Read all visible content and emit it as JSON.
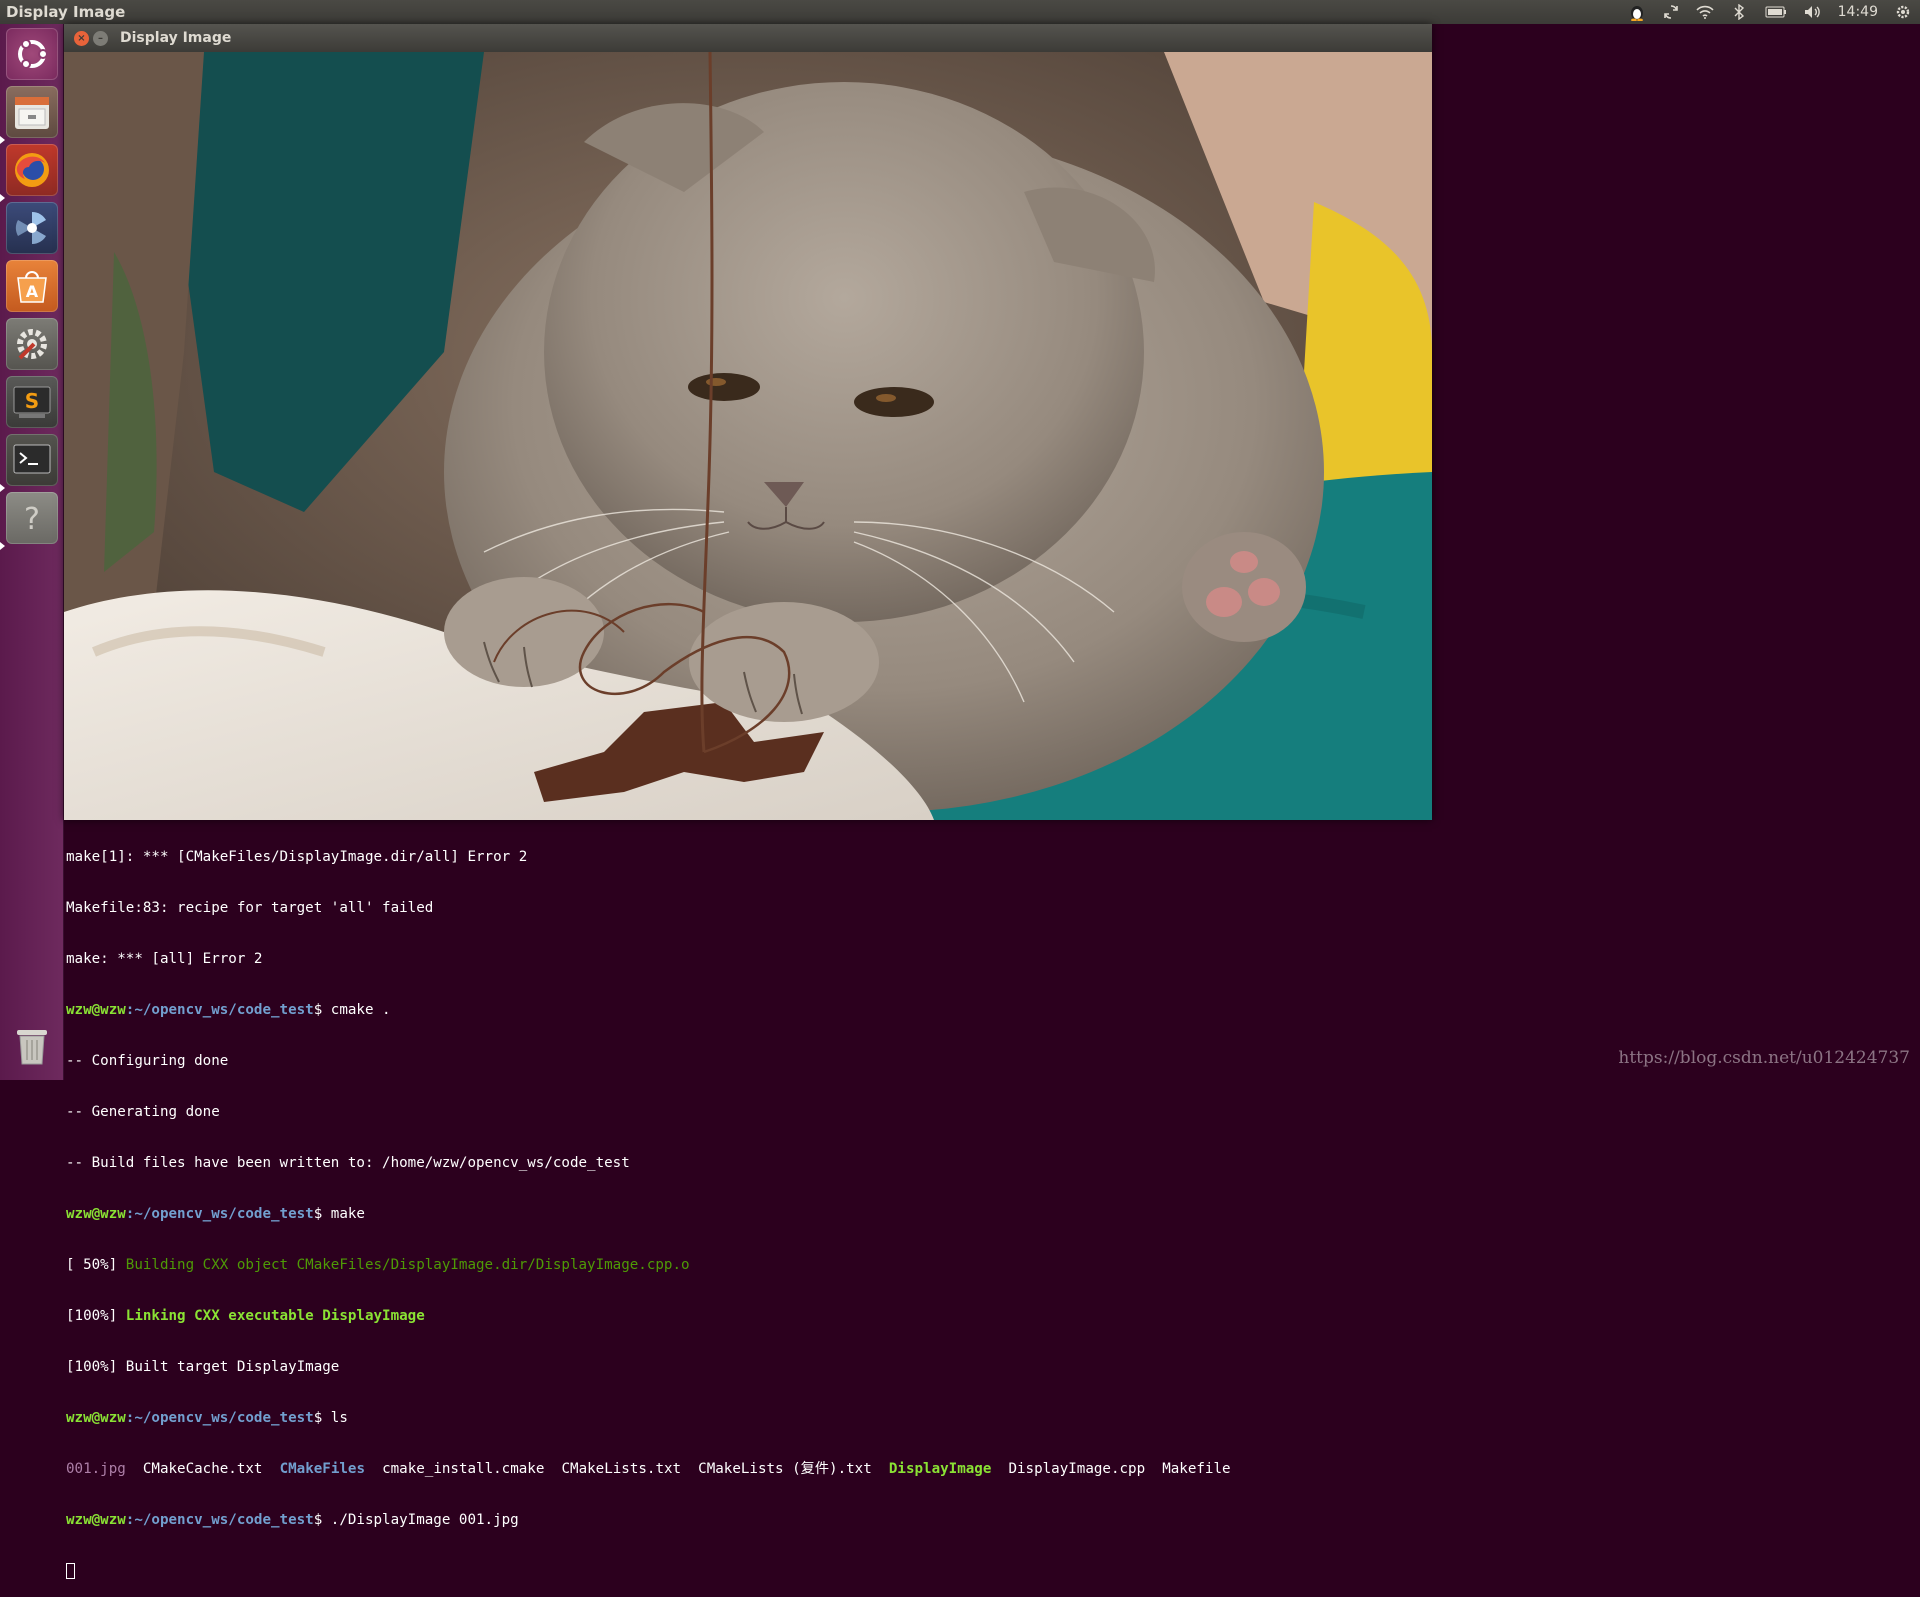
{
  "top_panel": {
    "app_title": "Display Image",
    "clock": "14:49",
    "tray_icons": [
      "qq-penguin-icon",
      "sync-icon",
      "wifi-icon",
      "bluetooth-icon",
      "battery-icon",
      "volume-icon",
      "gear-icon"
    ]
  },
  "launcher": {
    "items": [
      "ubuntu-dash-icon",
      "files-icon",
      "firefox-icon",
      "shotwell-icon",
      "software-center-icon",
      "system-settings-icon",
      "sublime-text-icon",
      "terminal-icon",
      "help-icon",
      "trash-icon"
    ]
  },
  "window": {
    "title": "Display Image",
    "close_glyph": "×",
    "min_glyph": "–"
  },
  "terminal": {
    "lines": [
      {
        "text": "make[1]: *** [CMakeFiles/DisplayImage.dir/all] Error 2"
      },
      {
        "text": "Makefile:83: recipe for target 'all' failed"
      },
      {
        "text": "make: *** [all] Error 2"
      },
      {
        "user": "wzw@wzw",
        "path": ":~/opencv_ws/code_test",
        "cmd": "$ cmake ."
      },
      {
        "text": "-- Configuring done"
      },
      {
        "text": "-- Generating done"
      },
      {
        "text": "-- Build files have been written to: /home/wzw/opencv_ws/code_test"
      },
      {
        "user": "wzw@wzw",
        "path": ":~/opencv_ws/code_test",
        "cmd": "$ make"
      },
      {
        "prefix": "[ 50%] ",
        "green": "Building CXX object CMakeFiles/DisplayImage.dir/DisplayImage.cpp.o"
      },
      {
        "prefix": "[100%] ",
        "bold_green": "Linking CXX executable DisplayImage"
      },
      {
        "text": "[100%] Built target DisplayImage"
      },
      {
        "user": "wzw@wzw",
        "path": ":~/opencv_ws/code_test",
        "cmd": "$ ls"
      },
      {
        "ls": [
          "001.jpg",
          "CMakeCache.txt",
          "CMakeFiles",
          "cmake_install.cmake",
          "CMakeLists.txt",
          "CMakeLists (复件).txt",
          "DisplayImage",
          "DisplayImage.cpp",
          "Makefile"
        ]
      },
      {
        "user": "wzw@wzw",
        "path": ":~/opencv_ws/code_test",
        "cmd": "$ ./DisplayImage 001.jpg"
      }
    ]
  },
  "watermark": "https://blog.csdn.net/u012424737"
}
